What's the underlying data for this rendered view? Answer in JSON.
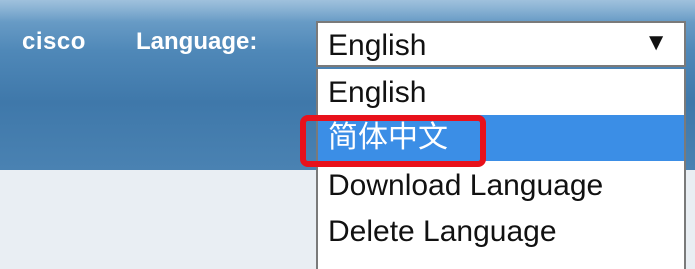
{
  "header": {
    "brand": "cisco",
    "language_label": "Language:"
  },
  "language_select": {
    "selected": "English",
    "arrow_icon": "triangle-down-icon",
    "options": [
      {
        "label": "English"
      },
      {
        "label": "简体中文"
      },
      {
        "label": "Download Language"
      },
      {
        "label": "Delete Language"
      }
    ]
  },
  "colors": {
    "header": "#4f88b8",
    "hover": "#3b8ee6",
    "highlight": "#e8111b"
  }
}
